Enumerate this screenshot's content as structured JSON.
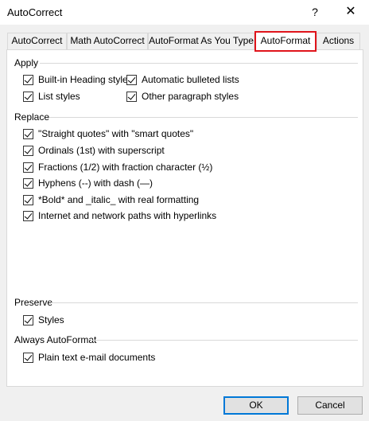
{
  "window": {
    "title": "AutoCorrect",
    "help_label": "?",
    "close_label": "✕"
  },
  "tabs": [
    {
      "label": "AutoCorrect"
    },
    {
      "label": "Math AutoCorrect"
    },
    {
      "label": "AutoFormat As You Type"
    },
    {
      "label": "AutoFormat"
    },
    {
      "label": "Actions"
    }
  ],
  "active_tab": "AutoFormat",
  "highlight_color": "#e0141b",
  "groups": {
    "apply": {
      "heading": "Apply",
      "options": [
        {
          "label": "Built-in Heading styles",
          "checked": true
        },
        {
          "label": "Automatic bulleted lists",
          "checked": true
        },
        {
          "label": "List styles",
          "checked": true
        },
        {
          "label": "Other paragraph styles",
          "checked": true
        }
      ]
    },
    "replace": {
      "heading": "Replace",
      "options": [
        {
          "label": "\"Straight quotes\" with \"smart quotes\"",
          "checked": true
        },
        {
          "label": "Ordinals (1st) with superscript",
          "checked": true
        },
        {
          "label": "Fractions (1/2) with fraction character (½)",
          "checked": true
        },
        {
          "label": "Hyphens (--) with dash (—)",
          "checked": true
        },
        {
          "label": "*Bold* and _italic_ with real formatting",
          "checked": true
        },
        {
          "label": "Internet and network paths with hyperlinks",
          "checked": true
        }
      ]
    },
    "preserve": {
      "heading": "Preserve",
      "options": [
        {
          "label": "Styles",
          "checked": true
        }
      ]
    },
    "always": {
      "heading": "Always AutoFormat",
      "options": [
        {
          "label": "Plain text e-mail documents",
          "checked": true
        }
      ]
    }
  },
  "buttons": {
    "ok": "OK",
    "cancel": "Cancel"
  }
}
